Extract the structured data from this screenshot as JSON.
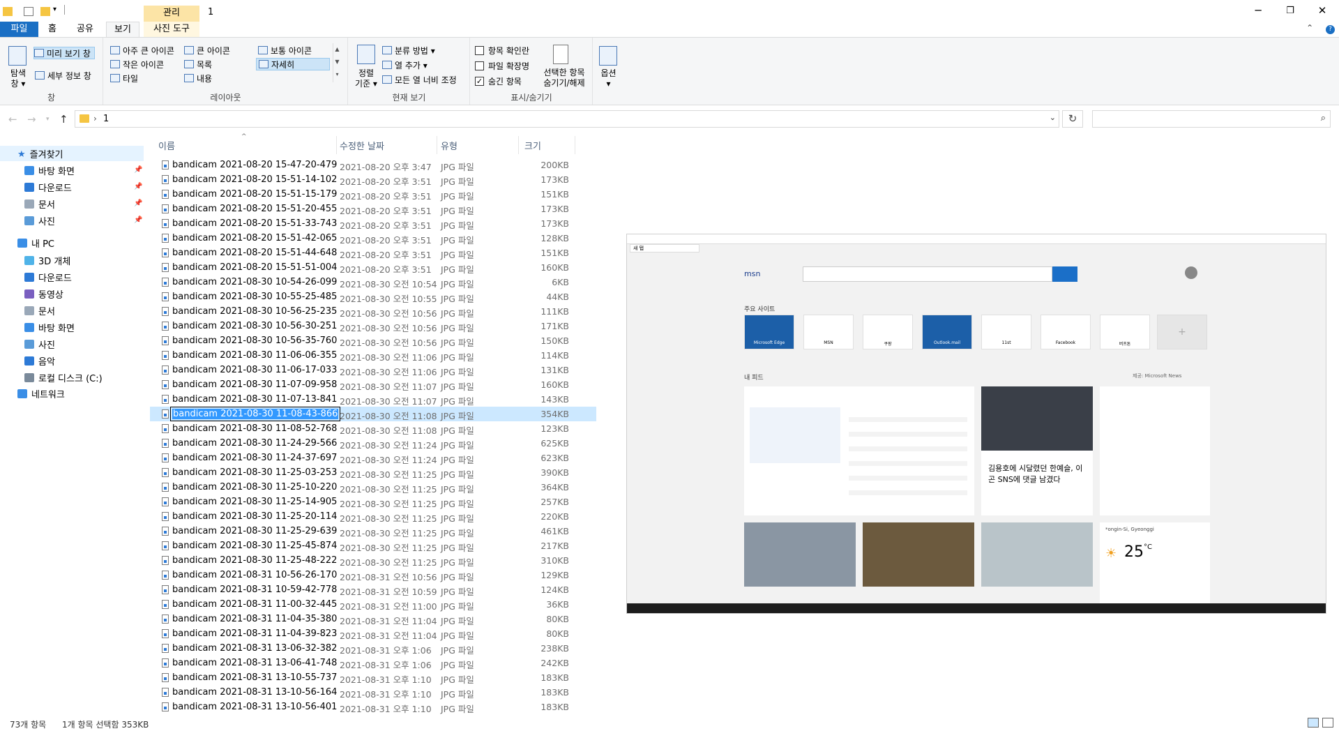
{
  "titlebar": {
    "context_tab_group": "관리",
    "window_title": "1",
    "minimize": "─",
    "restore": "❐",
    "close": "✕"
  },
  "ribbon_tabs": {
    "file": "파일",
    "home": "홈",
    "share": "공유",
    "view": "보기",
    "picture_tools": "사진 도구"
  },
  "ribbon": {
    "panes": {
      "navigation_pane": "탐색\n창",
      "navigation_pane_line1": "탐색",
      "navigation_pane_line2": "창 ▾",
      "preview_pane": "미리 보기 창",
      "details_pane": "세부 정보 창",
      "group": "창"
    },
    "layout": {
      "extra_large_icons": "아주 큰 아이콘",
      "large_icons": "큰 아이콘",
      "medium_icons": "보통 아이콘",
      "small_icons": "작은 아이콘",
      "list": "목록",
      "details": "자세히",
      "tiles": "타일",
      "content": "내용",
      "group": "레이아웃"
    },
    "current_view": {
      "sort_line1": "정렬",
      "sort_line2": "기준 ▾",
      "group_by": "분류 방법 ▾",
      "add_columns": "열 추가 ▾",
      "size_all_columns": "모든 열 너비 조정",
      "group": "현재 보기"
    },
    "show_hide": {
      "item_check_boxes": "항목 확인란",
      "file_name_extensions": "파일 확장명",
      "hidden_items": "숨긴 항목",
      "hide_selected_line1": "선택한 항목",
      "hide_selected_line2": "숨기기/해제",
      "group": "표시/숨기기"
    },
    "options": {
      "label": "옵션",
      "caret": "▾"
    }
  },
  "address": {
    "crumb": "1",
    "separator": "›",
    "search_placeholder": ""
  },
  "nav": {
    "quick_access": "즐겨찾기",
    "qa_items": [
      "바탕 화면",
      "다운로드",
      "문서",
      "사진"
    ],
    "this_pc": "내 PC",
    "pc_items": [
      "3D 개체",
      "다운로드",
      "동영상",
      "문서",
      "바탕 화면",
      "사진",
      "음악",
      "로컬 디스크 (C:)"
    ],
    "network": "네트워크"
  },
  "columns": {
    "name": "이름",
    "date": "수정한 날짜",
    "type": "유형",
    "size": "크기"
  },
  "files": [
    {
      "name": "bandicam 2021-08-20 15-47-20-479",
      "date": "2021-08-20 오후 3:47",
      "type": "JPG 파일",
      "size": "200KB"
    },
    {
      "name": "bandicam 2021-08-20 15-51-14-102",
      "date": "2021-08-20 오후 3:51",
      "type": "JPG 파일",
      "size": "173KB"
    },
    {
      "name": "bandicam 2021-08-20 15-51-15-179",
      "date": "2021-08-20 오후 3:51",
      "type": "JPG 파일",
      "size": "151KB"
    },
    {
      "name": "bandicam 2021-08-20 15-51-20-455",
      "date": "2021-08-20 오후 3:51",
      "type": "JPG 파일",
      "size": "173KB"
    },
    {
      "name": "bandicam 2021-08-20 15-51-33-743",
      "date": "2021-08-20 오후 3:51",
      "type": "JPG 파일",
      "size": "173KB"
    },
    {
      "name": "bandicam 2021-08-20 15-51-42-065",
      "date": "2021-08-20 오후 3:51",
      "type": "JPG 파일",
      "size": "128KB"
    },
    {
      "name": "bandicam 2021-08-20 15-51-44-648",
      "date": "2021-08-20 오후 3:51",
      "type": "JPG 파일",
      "size": "151KB"
    },
    {
      "name": "bandicam 2021-08-20 15-51-51-004",
      "date": "2021-08-20 오후 3:51",
      "type": "JPG 파일",
      "size": "160KB"
    },
    {
      "name": "bandicam 2021-08-30 10-54-26-099",
      "date": "2021-08-30 오전 10:54",
      "type": "JPG 파일",
      "size": "6KB"
    },
    {
      "name": "bandicam 2021-08-30 10-55-25-485",
      "date": "2021-08-30 오전 10:55",
      "type": "JPG 파일",
      "size": "44KB"
    },
    {
      "name": "bandicam 2021-08-30 10-56-25-235",
      "date": "2021-08-30 오전 10:56",
      "type": "JPG 파일",
      "size": "111KB"
    },
    {
      "name": "bandicam 2021-08-30 10-56-30-251",
      "date": "2021-08-30 오전 10:56",
      "type": "JPG 파일",
      "size": "171KB"
    },
    {
      "name": "bandicam 2021-08-30 10-56-35-760",
      "date": "2021-08-30 오전 10:56",
      "type": "JPG 파일",
      "size": "150KB"
    },
    {
      "name": "bandicam 2021-08-30 11-06-06-355",
      "date": "2021-08-30 오전 11:06",
      "type": "JPG 파일",
      "size": "114KB"
    },
    {
      "name": "bandicam 2021-08-30 11-06-17-033",
      "date": "2021-08-30 오전 11:06",
      "type": "JPG 파일",
      "size": "131KB"
    },
    {
      "name": "bandicam 2021-08-30 11-07-09-958",
      "date": "2021-08-30 오전 11:07",
      "type": "JPG 파일",
      "size": "160KB"
    },
    {
      "name": "bandicam 2021-08-30 11-07-13-841",
      "date": "2021-08-30 오전 11:07",
      "type": "JPG 파일",
      "size": "143KB"
    },
    {
      "name": "bandicam 2021-08-30 11-08-43-866",
      "date": "2021-08-30 오전 11:08",
      "type": "JPG 파일",
      "size": "354KB",
      "selected": true
    },
    {
      "name": "bandicam 2021-08-30 11-08-52-768",
      "date": "2021-08-30 오전 11:08",
      "type": "JPG 파일",
      "size": "123KB"
    },
    {
      "name": "bandicam 2021-08-30 11-24-29-566",
      "date": "2021-08-30 오전 11:24",
      "type": "JPG 파일",
      "size": "625KB"
    },
    {
      "name": "bandicam 2021-08-30 11-24-37-697",
      "date": "2021-08-30 오전 11:24",
      "type": "JPG 파일",
      "size": "623KB"
    },
    {
      "name": "bandicam 2021-08-30 11-25-03-253",
      "date": "2021-08-30 오전 11:25",
      "type": "JPG 파일",
      "size": "390KB"
    },
    {
      "name": "bandicam 2021-08-30 11-25-10-220",
      "date": "2021-08-30 오전 11:25",
      "type": "JPG 파일",
      "size": "364KB"
    },
    {
      "name": "bandicam 2021-08-30 11-25-14-905",
      "date": "2021-08-30 오전 11:25",
      "type": "JPG 파일",
      "size": "257KB"
    },
    {
      "name": "bandicam 2021-08-30 11-25-20-114",
      "date": "2021-08-30 오전 11:25",
      "type": "JPG 파일",
      "size": "220KB"
    },
    {
      "name": "bandicam 2021-08-30 11-25-29-639",
      "date": "2021-08-30 오전 11:25",
      "type": "JPG 파일",
      "size": "461KB"
    },
    {
      "name": "bandicam 2021-08-30 11-25-45-874",
      "date": "2021-08-30 오전 11:25",
      "type": "JPG 파일",
      "size": "217KB"
    },
    {
      "name": "bandicam 2021-08-30 11-25-48-222",
      "date": "2021-08-30 오전 11:25",
      "type": "JPG 파일",
      "size": "310KB"
    },
    {
      "name": "bandicam 2021-08-31 10-56-26-170",
      "date": "2021-08-31 오전 10:56",
      "type": "JPG 파일",
      "size": "129KB"
    },
    {
      "name": "bandicam 2021-08-31 10-59-42-778",
      "date": "2021-08-31 오전 10:59",
      "type": "JPG 파일",
      "size": "124KB"
    },
    {
      "name": "bandicam 2021-08-31 11-00-32-445",
      "date": "2021-08-31 오전 11:00",
      "type": "JPG 파일",
      "size": "36KB"
    },
    {
      "name": "bandicam 2021-08-31 11-04-35-380",
      "date": "2021-08-31 오전 11:04",
      "type": "JPG 파일",
      "size": "80KB"
    },
    {
      "name": "bandicam 2021-08-31 11-04-39-823",
      "date": "2021-08-31 오전 11:04",
      "type": "JPG 파일",
      "size": "80KB"
    },
    {
      "name": "bandicam 2021-08-31 13-06-32-382",
      "date": "2021-08-31 오후 1:06",
      "type": "JPG 파일",
      "size": "238KB"
    },
    {
      "name": "bandicam 2021-08-31 13-06-41-748",
      "date": "2021-08-31 오후 1:06",
      "type": "JPG 파일",
      "size": "242KB"
    },
    {
      "name": "bandicam 2021-08-31 13-10-55-737",
      "date": "2021-08-31 오후 1:10",
      "type": "JPG 파일",
      "size": "183KB"
    },
    {
      "name": "bandicam 2021-08-31 13-10-56-164",
      "date": "2021-08-31 오후 1:10",
      "type": "JPG 파일",
      "size": "183KB"
    },
    {
      "name": "bandicam 2021-08-31 13-10-56-401",
      "date": "2021-08-31 오후 1:10",
      "type": "JPG 파일",
      "size": "183KB"
    }
  ],
  "preview": {
    "tab_label": "새 탭",
    "msn_logo": "msn",
    "top_sites_label": "주요 사이트",
    "tiles": [
      "Microsoft Edge",
      "MSN",
      "쿠팡",
      "Outlook.mail",
      "11st",
      "Facebook",
      "버프톤"
    ],
    "feed_label": "내 피드",
    "feed_source": "제공: Microsoft News",
    "headline": "김용호에 시달렸던 한예슬, 이곤 SNS에 댓글 남겼다",
    "temperature": "25",
    "temp_unit": "°C",
    "weather_location": "*ongin-Si, Gyeonggi"
  },
  "status": {
    "item_count": "73개 항목",
    "selection": "1개 항목 선택함 353KB"
  },
  "colors": {
    "accent": "#1a6fc4",
    "selection_bg": "#cce8ff",
    "context_tab": "#fce4a6"
  }
}
